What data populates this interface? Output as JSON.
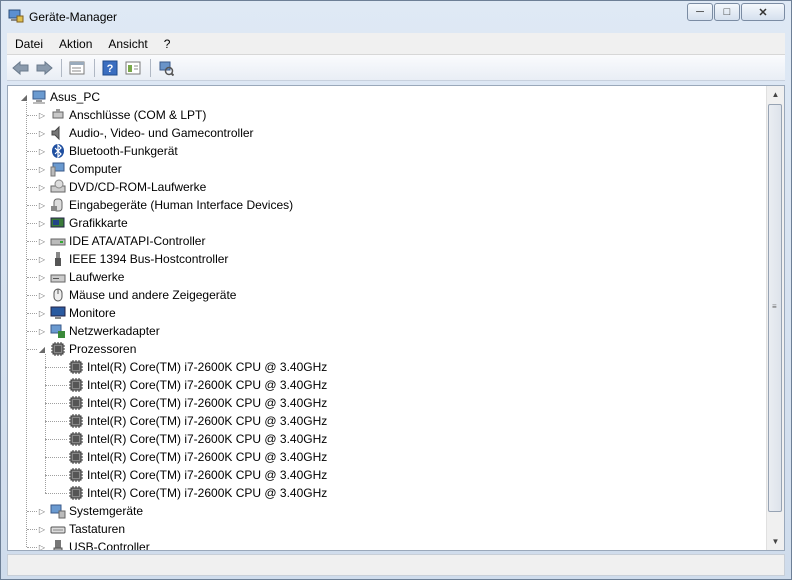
{
  "window": {
    "title": "Geräte-Manager"
  },
  "menu": [
    "Datei",
    "Aktion",
    "Ansicht",
    "?"
  ],
  "toolbar": [
    "back-arrow-icon",
    "forward-arrow-icon",
    "properties-icon",
    "help-icon",
    "show-hide-icon",
    "scan-hardware-icon"
  ],
  "tree": {
    "root": "Asus_PC",
    "categories": [
      {
        "label": "Anschlüsse (COM & LPT)",
        "icon": "port-icon"
      },
      {
        "label": "Audio-, Video- und Gamecontroller",
        "icon": "speaker-icon"
      },
      {
        "label": "Bluetooth-Funkgerät",
        "icon": "bluetooth-icon"
      },
      {
        "label": "Computer",
        "icon": "computer-icon"
      },
      {
        "label": "DVD/CD-ROM-Laufwerke",
        "icon": "dvd-drive-icon"
      },
      {
        "label": "Eingabegeräte (Human Interface Devices)",
        "icon": "hid-icon"
      },
      {
        "label": "Grafikkarte",
        "icon": "display-adapter-icon"
      },
      {
        "label": "IDE ATA/ATAPI-Controller",
        "icon": "ide-controller-icon"
      },
      {
        "label": "IEEE 1394 Bus-Hostcontroller",
        "icon": "firewire-icon"
      },
      {
        "label": "Laufwerke",
        "icon": "disk-drive-icon"
      },
      {
        "label": "Mäuse und andere Zeigegeräte",
        "icon": "mouse-icon"
      },
      {
        "label": "Monitore",
        "icon": "monitor-icon"
      },
      {
        "label": "Netzwerkadapter",
        "icon": "network-adapter-icon"
      },
      {
        "label": "Prozessoren",
        "icon": "processor-icon",
        "expanded": true
      },
      {
        "label": "Systemgeräte",
        "icon": "system-devices-icon"
      },
      {
        "label": "Tastaturen",
        "icon": "keyboard-icon"
      },
      {
        "label": "USB-Controller",
        "icon": "usb-icon"
      }
    ],
    "processors": [
      "Intel(R) Core(TM) i7-2600K CPU @ 3.40GHz",
      "Intel(R) Core(TM) i7-2600K CPU @ 3.40GHz",
      "Intel(R) Core(TM) i7-2600K CPU @ 3.40GHz",
      "Intel(R) Core(TM) i7-2600K CPU @ 3.40GHz",
      "Intel(R) Core(TM) i7-2600K CPU @ 3.40GHz",
      "Intel(R) Core(TM) i7-2600K CPU @ 3.40GHz",
      "Intel(R) Core(TM) i7-2600K CPU @ 3.40GHz",
      "Intel(R) Core(TM) i7-2600K CPU @ 3.40GHz"
    ]
  }
}
